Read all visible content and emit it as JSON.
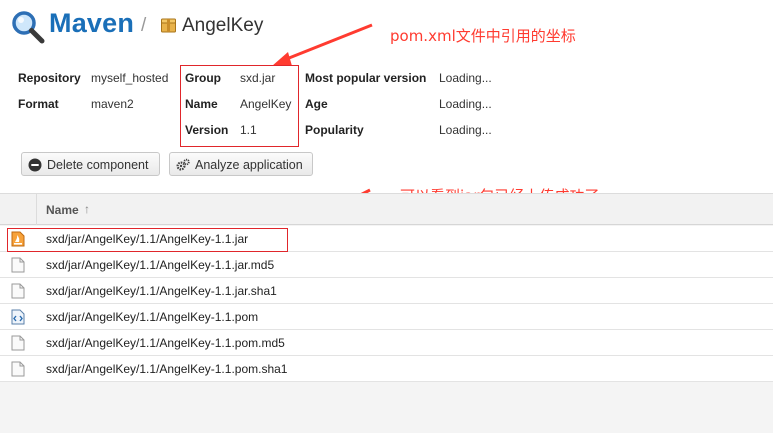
{
  "header": {
    "title": "Maven",
    "separator": "/",
    "component": "AngelKey"
  },
  "annotations": {
    "top": "pom.xml文件中引用的坐标",
    "middle": "可以看到jar包已经上传成功了"
  },
  "info": {
    "repository_label": "Repository",
    "repository_value": "myself_hosted",
    "format_label": "Format",
    "format_value": "maven2",
    "group_label": "Group",
    "group_value": "sxd.jar",
    "name_label": "Name",
    "name_value": "AngelKey",
    "version_label": "Version",
    "version_value": "1.1",
    "popular_label": "Most popular version",
    "popular_value": "Loading...",
    "age_label": "Age",
    "age_value": "Loading...",
    "popularity_label": "Popularity",
    "popularity_value": "Loading..."
  },
  "toolbar": {
    "delete_label": "Delete component",
    "analyze_label": "Analyze application"
  },
  "table": {
    "name_header": "Name",
    "sort_indicator": "↑",
    "rows": [
      {
        "path": "sxd/jar/AngelKey/1.1/AngelKey-1.1.jar",
        "icon": "jar-file-icon"
      },
      {
        "path": "sxd/jar/AngelKey/1.1/AngelKey-1.1.jar.md5",
        "icon": "file-icon"
      },
      {
        "path": "sxd/jar/AngelKey/1.1/AngelKey-1.1.jar.sha1",
        "icon": "file-icon"
      },
      {
        "path": "sxd/jar/AngelKey/1.1/AngelKey-1.1.pom",
        "icon": "xml-file-icon"
      },
      {
        "path": "sxd/jar/AngelKey/1.1/AngelKey-1.1.pom.md5",
        "icon": "file-icon"
      },
      {
        "path": "sxd/jar/AngelKey/1.1/AngelKey-1.1.pom.sha1",
        "icon": "file-icon"
      }
    ]
  },
  "colors": {
    "brand": "#1a6fb8",
    "annotation": "#ff3b30",
    "highlight_box": "#e0262b"
  }
}
